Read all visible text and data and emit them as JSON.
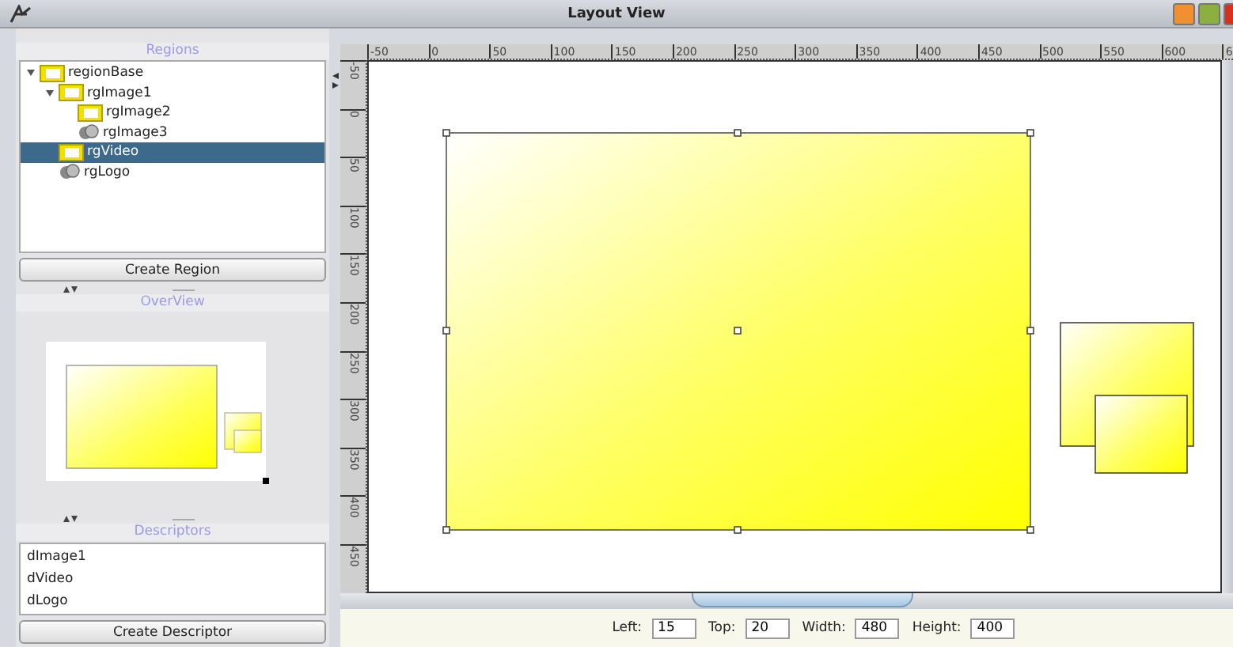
{
  "window": {
    "title": "Layout View"
  },
  "regions_panel": {
    "title": "Regions",
    "tree": [
      {
        "label": "regionBase",
        "kind": "region",
        "expanded": true,
        "selected": false,
        "children": [
          {
            "label": "rgImage1",
            "kind": "region",
            "expanded": true,
            "selected": false,
            "children": [
              {
                "label": "rgImage2",
                "kind": "region",
                "selected": false
              },
              {
                "label": "rgImage3",
                "kind": "media",
                "selected": false
              }
            ]
          },
          {
            "label": "rgVideo",
            "kind": "region",
            "selected": true
          },
          {
            "label": "rgLogo",
            "kind": "media",
            "selected": false
          }
        ]
      }
    ],
    "button": "Create Region"
  },
  "overview_panel": {
    "title": "OverView"
  },
  "descriptors_panel": {
    "title": "Descriptors",
    "items": [
      "dImage1",
      "dVideo",
      "dLogo"
    ],
    "button": "Create Descriptor"
  },
  "ruler_horizontal": [
    "-50",
    "0",
    "50",
    "100",
    "150",
    "200",
    "250",
    "300",
    "350",
    "400",
    "450",
    "500",
    "550",
    "600",
    "6"
  ],
  "ruler_vertical": [
    "-50",
    "0",
    "50",
    "100",
    "150",
    "200",
    "250",
    "300",
    "350",
    "400",
    "450"
  ],
  "fields": [
    {
      "label": "Left:",
      "value": "15"
    },
    {
      "label": "Top:",
      "value": "20"
    },
    {
      "label": "Width:",
      "value": "480"
    },
    {
      "label": "Height:",
      "value": "400"
    }
  ]
}
